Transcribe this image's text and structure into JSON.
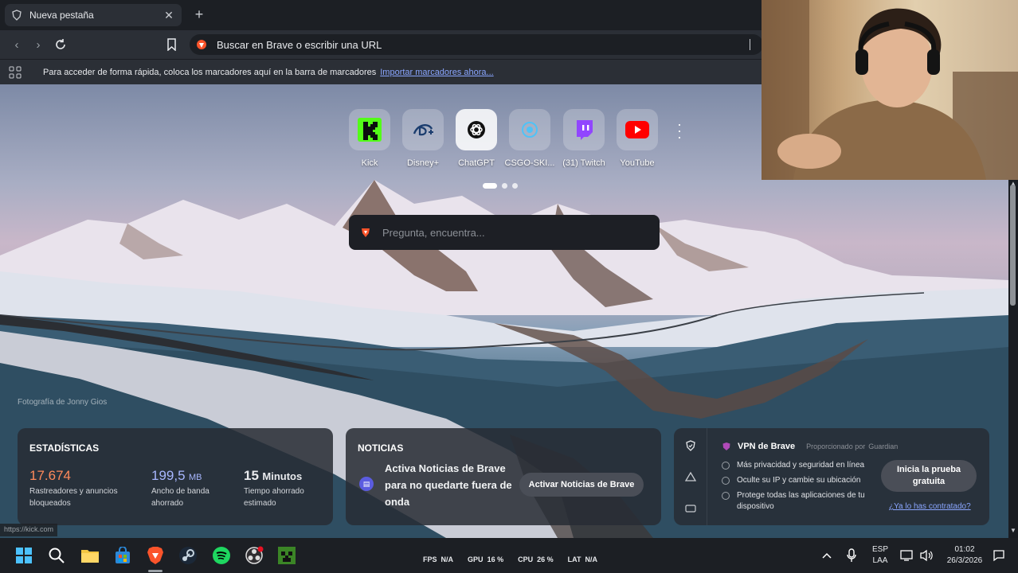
{
  "browser": {
    "tab_title": "Nueva pestaña",
    "url_placeholder": "Buscar en Brave o escribir una URL",
    "bookmarks_hint": "Para acceder de forma rápida, coloca los marcadores aquí en la barra de marcadores",
    "bookmarks_import": "Importar marcadores ahora..."
  },
  "top_sites": [
    {
      "label": "Kick",
      "icon": "kick-icon",
      "color": "#53fc18"
    },
    {
      "label": "Disney+",
      "icon": "disney-plus-icon",
      "color": "#1a3c6e"
    },
    {
      "label": "ChatGPT",
      "icon": "chatgpt-icon",
      "color": "#ffffff"
    },
    {
      "label": "CSGO-SKI...",
      "icon": "csgo-skins-icon",
      "color": "#4fc3f7"
    },
    {
      "label": "(31) Twitch",
      "icon": "twitch-icon",
      "color": "#9146ff"
    },
    {
      "label": "YouTube",
      "icon": "youtube-icon",
      "color": "#ff0000"
    }
  ],
  "search_placeholder": "Pregunta, encuentra...",
  "photo_credit": "Fotografía de Jonny Gios",
  "stats": {
    "title": "ESTADÍSTICAS",
    "trackers_value": "17.674",
    "trackers_label": "Rastreadores y anuncios bloqueados",
    "bandwidth_value": "199,5",
    "bandwidth_unit": "MB",
    "bandwidth_label": "Ancho de banda ahorrado",
    "time_value": "15",
    "time_unit": "Minutos",
    "time_label": "Tiempo ahorrado estimado",
    "trackers_color": "#ff8a5b",
    "bandwidth_color": "#a8b7ff"
  },
  "news": {
    "title": "NOTICIAS",
    "text": "Activa Noticias de Brave para no quedarte fuera de onda",
    "button": "Activar Noticias de Brave"
  },
  "vpn": {
    "title": "VPN de Brave",
    "powered": "Proporcionado por",
    "provider": "Guardian",
    "features": [
      "Más privacidad y seguridad en línea",
      "Oculte su IP y cambie su ubicación",
      "Protege todas las aplicaciones de tu dispositivo"
    ],
    "trial_button": "Inicia la prueba gratuita",
    "contracted_link": "¿Ya lo has contratado?"
  },
  "status_url": "https://kick.com",
  "taskbar": {
    "perf": [
      {
        "label": "FPS",
        "value": "N/A"
      },
      {
        "label": "GPU",
        "value": "16 %"
      },
      {
        "label": "CPU",
        "value": "26 %"
      },
      {
        "label": "LAT",
        "value": "N/A"
      }
    ],
    "lang_top": "ESP",
    "lang_bottom": "LAA",
    "time": "01:02",
    "date": "26/3/2026"
  }
}
